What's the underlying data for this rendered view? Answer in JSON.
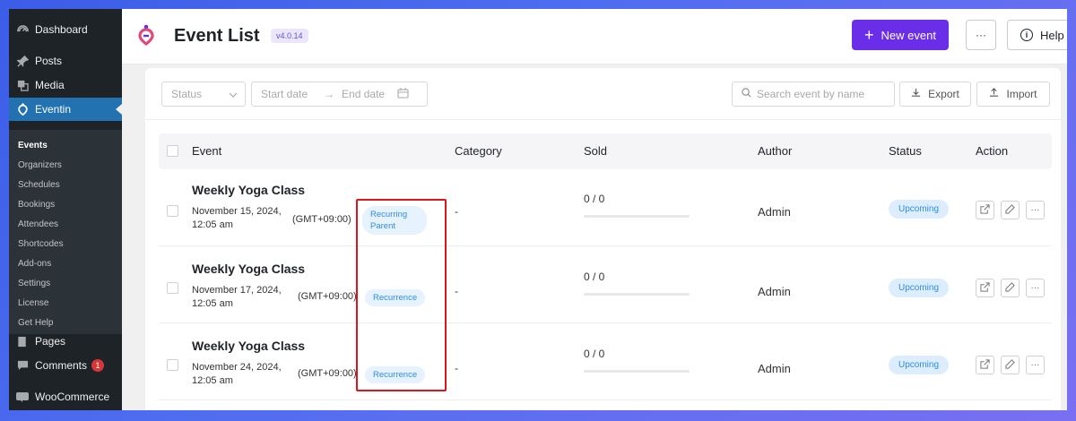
{
  "sidebar": {
    "items": [
      {
        "label": "Dashboard",
        "icon": "dashboard-icon"
      },
      {
        "label": "Posts",
        "icon": "pin-icon"
      },
      {
        "label": "Media",
        "icon": "media-icon"
      },
      {
        "label": "Eventin",
        "icon": "eventin-icon"
      }
    ],
    "submenu": [
      "Events",
      "Organizers",
      "Schedules",
      "Bookings",
      "Attendees",
      "Shortcodes",
      "Add-ons",
      "Settings",
      "License",
      "Get Help"
    ],
    "lower_items": [
      {
        "label": "Pages",
        "icon": "pages-icon"
      },
      {
        "label": "Comments",
        "icon": "comments-icon",
        "badge": "1"
      },
      {
        "label": "WooCommerce",
        "icon": "woocommerce-icon"
      }
    ]
  },
  "header": {
    "title": "Event List",
    "version": "v4.0.14",
    "new_event_label": "New event",
    "more_label": "···",
    "help_label": "Help"
  },
  "filters": {
    "status_placeholder": "Status",
    "start_date_placeholder": "Start date",
    "end_date_placeholder": "End date",
    "search_placeholder": "Search event by name",
    "export_label": "Export",
    "import_label": "Import"
  },
  "table": {
    "columns": [
      "Event",
      "Category",
      "Sold",
      "Author",
      "Status",
      "Action"
    ],
    "rows": [
      {
        "name": "Weekly Yoga Class",
        "date": "November 15, 2024, 12:05 am",
        "timezone": "(GMT+09:00)",
        "tag": "Recurring Parent",
        "category": "-",
        "sold": "0 / 0",
        "sold_fraction": 0,
        "author": "Admin",
        "status": "Upcoming"
      },
      {
        "name": "Weekly Yoga Class",
        "date": "November 17, 2024, 12:05 am",
        "timezone": "(GMT+09:00)",
        "tag": "Recurrence",
        "category": "-",
        "sold": "0 / 0",
        "sold_fraction": 0,
        "author": "Admin",
        "status": "Upcoming"
      },
      {
        "name": "Weekly Yoga Class",
        "date": "November 24, 2024, 12:05 am",
        "timezone": "(GMT+09:00)",
        "tag": "Recurrence",
        "category": "-",
        "sold": "0 / 0",
        "sold_fraction": 0,
        "author": "Admin",
        "status": "Upcoming"
      }
    ]
  },
  "colors": {
    "accent": "#6b2ee8",
    "wp_sidebar": "#1d2327",
    "wp_active": "#2271b1",
    "tag_blue": "#2f8ce4",
    "highlight_red": "#e0141e"
  }
}
